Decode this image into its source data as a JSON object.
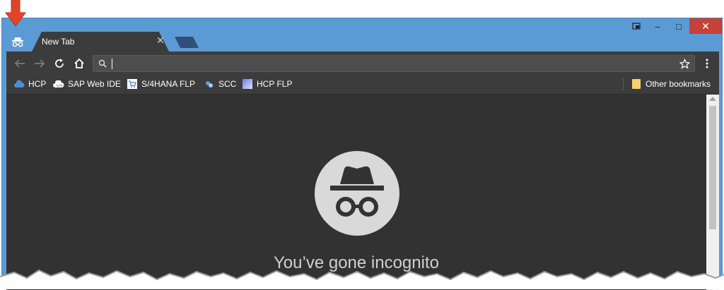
{
  "window": {
    "caption": {
      "restore_icon": "window-restore-icon",
      "minimize": "–",
      "maximize": "□",
      "close": "✕"
    }
  },
  "tab": {
    "title": "New Tab",
    "close": "✕"
  },
  "bookmarks": [
    {
      "label": "HCP",
      "icon": "cloud-icon"
    },
    {
      "label": "SAP Web IDE",
      "icon": "webide-icon"
    },
    {
      "label": "S/4HANA FLP",
      "icon": "cart-icon"
    },
    {
      "label": "SCC",
      "icon": "connector-icon"
    },
    {
      "label": "HCP FLP",
      "icon": "launchpad-icon"
    }
  ],
  "other_bookmarks": {
    "label": "Other bookmarks",
    "icon": "folder-icon"
  },
  "omnibox": {
    "value": "",
    "icon": "search-icon"
  },
  "incognito": {
    "headline": "You’ve gone incognito"
  },
  "colors": {
    "frame": "#5b9bd5",
    "toolbar": "#3c3c3c",
    "content": "#323232",
    "close": "#c7403a",
    "arrow": "#e0452a"
  }
}
